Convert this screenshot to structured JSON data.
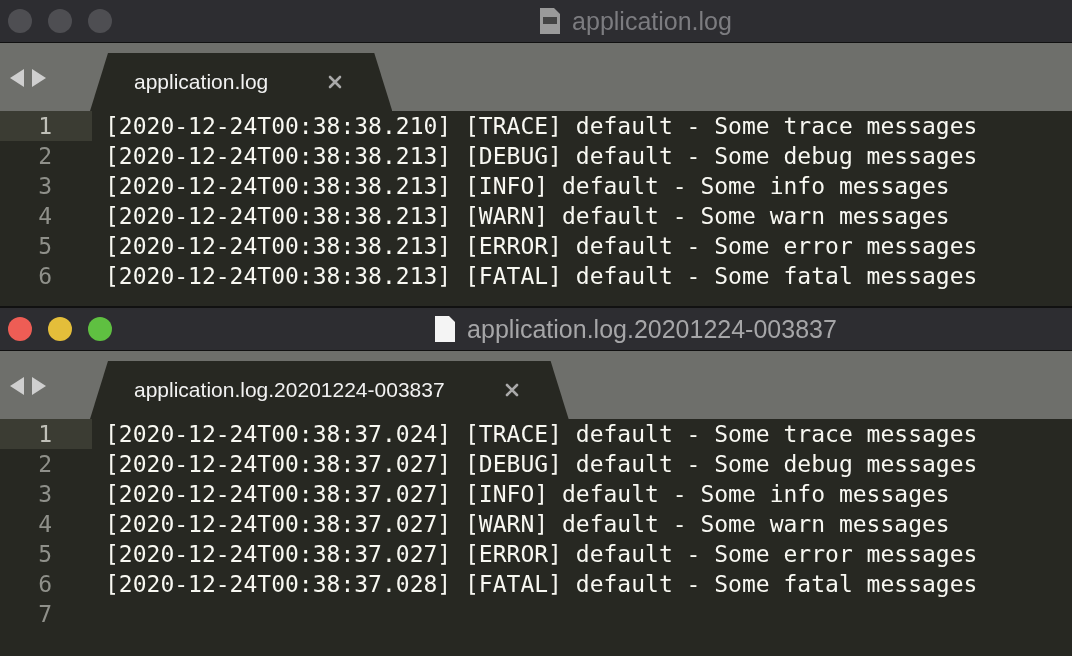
{
  "windows": [
    {
      "active": false,
      "title": "application.log",
      "tabs": [
        {
          "label": "application.log",
          "selected": true
        }
      ],
      "lines": [
        {
          "number": "1",
          "text": "[2020-12-24T00:38:38.210] [TRACE] default - Some trace messages",
          "current": true
        },
        {
          "number": "2",
          "text": "[2020-12-24T00:38:38.213] [DEBUG] default - Some debug messages",
          "current": false
        },
        {
          "number": "3",
          "text": "[2020-12-24T00:38:38.213] [INFO] default - Some info messages",
          "current": false
        },
        {
          "number": "4",
          "text": "[2020-12-24T00:38:38.213] [WARN] default - Some warn messages",
          "current": false
        },
        {
          "number": "5",
          "text": "[2020-12-24T00:38:38.213] [ERROR] default - Some error messages",
          "current": false
        },
        {
          "number": "6",
          "text": "[2020-12-24T00:38:38.213] [FATAL] default - Some fatal messages",
          "current": false
        }
      ]
    },
    {
      "active": true,
      "title": "application.log.20201224-003837",
      "tabs": [
        {
          "label": "application.log.20201224-003837",
          "selected": true
        }
      ],
      "lines": [
        {
          "number": "1",
          "text": "[2020-12-24T00:38:37.024] [TRACE] default - Some trace messages",
          "current": true
        },
        {
          "number": "2",
          "text": "[2020-12-24T00:38:37.027] [DEBUG] default - Some debug messages",
          "current": false
        },
        {
          "number": "3",
          "text": "[2020-12-24T00:38:37.027] [INFO] default - Some info messages",
          "current": false
        },
        {
          "number": "4",
          "text": "[2020-12-24T00:38:37.027] [WARN] default - Some warn messages",
          "current": false
        },
        {
          "number": "5",
          "text": "[2020-12-24T00:38:37.027] [ERROR] default - Some error messages",
          "current": false
        },
        {
          "number": "6",
          "text": "[2020-12-24T00:38:37.028] [FATAL] default - Some fatal messages",
          "current": false
        },
        {
          "number": "7",
          "current": false
        }
      ]
    }
  ]
}
